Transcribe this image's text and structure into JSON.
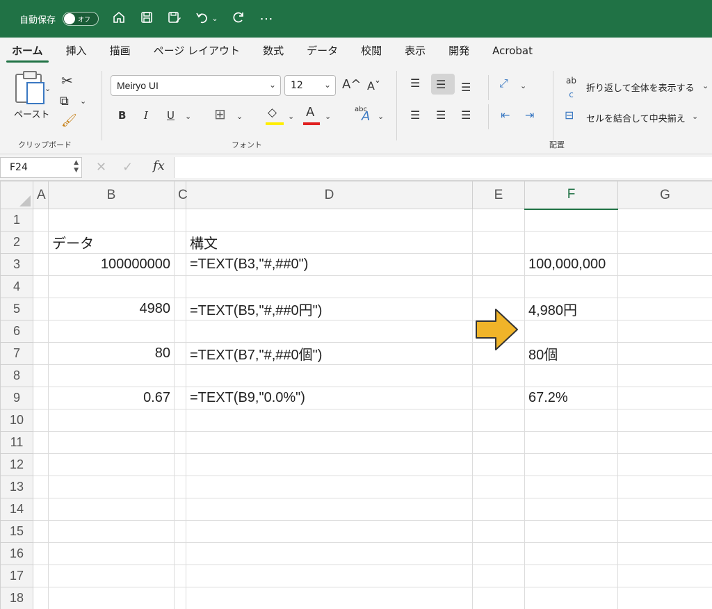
{
  "titlebar": {
    "autosave_label": "自動保存",
    "toggle_state": "オフ",
    "icons": [
      "home-icon",
      "save-icon",
      "save-as-icon",
      "undo-icon",
      "chevron-down-icon",
      "redo-icon",
      "more-icon"
    ],
    "bg_color": "#207245"
  },
  "tabs": [
    "ホーム",
    "挿入",
    "描画",
    "ページ レイアウト",
    "数式",
    "データ",
    "校閲",
    "表示",
    "開発",
    "Acrobat"
  ],
  "ribbon": {
    "clipboard": {
      "paste_label": "ペースト",
      "group_label": "クリップボード"
    },
    "font": {
      "name": "Meiryo UI",
      "size": "12",
      "group_label": "フォント",
      "bold": "B",
      "italic": "I",
      "underline": "U",
      "grow": "A^",
      "shrink": "Aˇ",
      "font_color": "A",
      "phonetic_small": "abc",
      "phonetic_big": "A",
      "fill_color_hex": "#ffee00",
      "font_color_hex": "#e02020"
    },
    "alignment": {
      "group_label": "配置",
      "wrap_text": "折り返して全体を表示する",
      "merge_center": "セルを結合して中央揃え",
      "wrap_icon_small": "ab",
      "wrap_icon_sub": "c"
    }
  },
  "formula_bar": {
    "name_box": "F24",
    "fx": "fx",
    "formula": ""
  },
  "sheet": {
    "columns": [
      "A",
      "B",
      "C",
      "D",
      "E",
      "F",
      "G"
    ],
    "selected_column": "F",
    "row_numbers": [
      "1",
      "2",
      "3",
      "4",
      "5",
      "6",
      "7",
      "8",
      "9",
      "10",
      "11",
      "12",
      "13",
      "14",
      "15",
      "16",
      "17",
      "18"
    ],
    "cells": {
      "B2": "データ",
      "D2": "構文",
      "B3": "100000000",
      "D3": "=TEXT(B3,\"#,##0\")",
      "F3": "100,000,000",
      "B5": "4980",
      "D5": "=TEXT(B5,\"#,##0円\")",
      "F5": "4,980円",
      "B7": "80",
      "D7": "=TEXT(B7,\"#,##0個\")",
      "F7": "80個",
      "B9": "0.67",
      "D9": "=TEXT(B9,\"0.0%\")",
      "F9": "67.2%"
    },
    "arrow_color": "#f0b429"
  }
}
